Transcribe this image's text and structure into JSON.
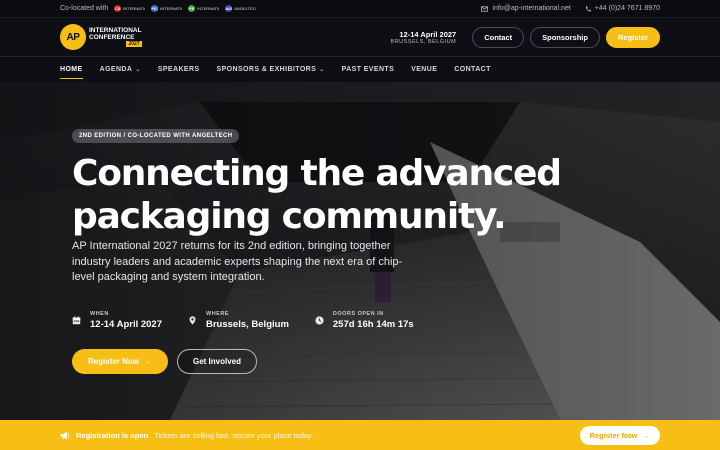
{
  "topbar": {
    "colocated_label": "Co-located with",
    "colocated_logos": [
      {
        "abbr": "CS",
        "name": "INTERNATIONAL CONFERENCE",
        "color": "#d9262b"
      },
      {
        "abbr": "PIC",
        "name": "INTERNATIONAL CONFERENCE",
        "color": "#2f6fd0"
      },
      {
        "abbr": "PE",
        "name": "INTERNATIONAL CONFERENCE",
        "color": "#41a343"
      },
      {
        "abbr": "AIS",
        "name": "ANGELTECH SUMMIT",
        "color": "#3b4bb5"
      }
    ],
    "email": "info@ap-international.net",
    "phone": "+44 (0)24 7671 8970",
    "email_icon": "envelope-icon",
    "phone_icon": "phone-icon"
  },
  "header": {
    "logo_mark": "AP",
    "logo_line1": "INTERNATIONAL",
    "logo_line2": "CONFERENCE",
    "logo_badge": "2027",
    "date": "12-14 April 2027",
    "location": "BRUSSELS, BELGIUM",
    "buttons": {
      "contact": "Contact",
      "sponsorship": "Sponsorship",
      "register": "Register"
    }
  },
  "nav": {
    "items": [
      {
        "label": "HOME",
        "active": true
      },
      {
        "label": "AGENDA",
        "dropdown": true
      },
      {
        "label": "SPEAKERS"
      },
      {
        "label": "SPONSORS & EXHIBITORS",
        "dropdown": true
      },
      {
        "label": "PAST EVENTS"
      },
      {
        "label": "VENUE"
      },
      {
        "label": "CONTACT"
      }
    ]
  },
  "hero": {
    "tag": "2ND EDITION / CO-LOCATED WITH ANGELTECH",
    "headline_line1": "Connecting the advanced",
    "headline_line2": "packaging community.",
    "subtitle": "AP International 2027 returns for its 2nd edition, bringing together industry leaders and academic experts shaping the next era of chip-level packaging and system integration.",
    "facts": [
      {
        "label": "WHEN",
        "value": "12-14 April 2027",
        "icon": "calendar-icon"
      },
      {
        "label": "WHERE",
        "value": "Brussels, Belgium",
        "icon": "map-pin-icon"
      },
      {
        "label": "DOORS OPEN IN",
        "value": "257d 16h 14m 17s",
        "icon": "clock-icon"
      }
    ],
    "cta_primary": "Register Now",
    "cta_secondary": "Get Involved"
  },
  "bottombar": {
    "status_bold": "Registration is open",
    "status_text": "Tickets are selling fast, secure your place today.",
    "button": "Register Now",
    "icon": "megaphone-icon"
  },
  "colors": {
    "accent": "#f7bf16",
    "background": "#0e0f14"
  }
}
